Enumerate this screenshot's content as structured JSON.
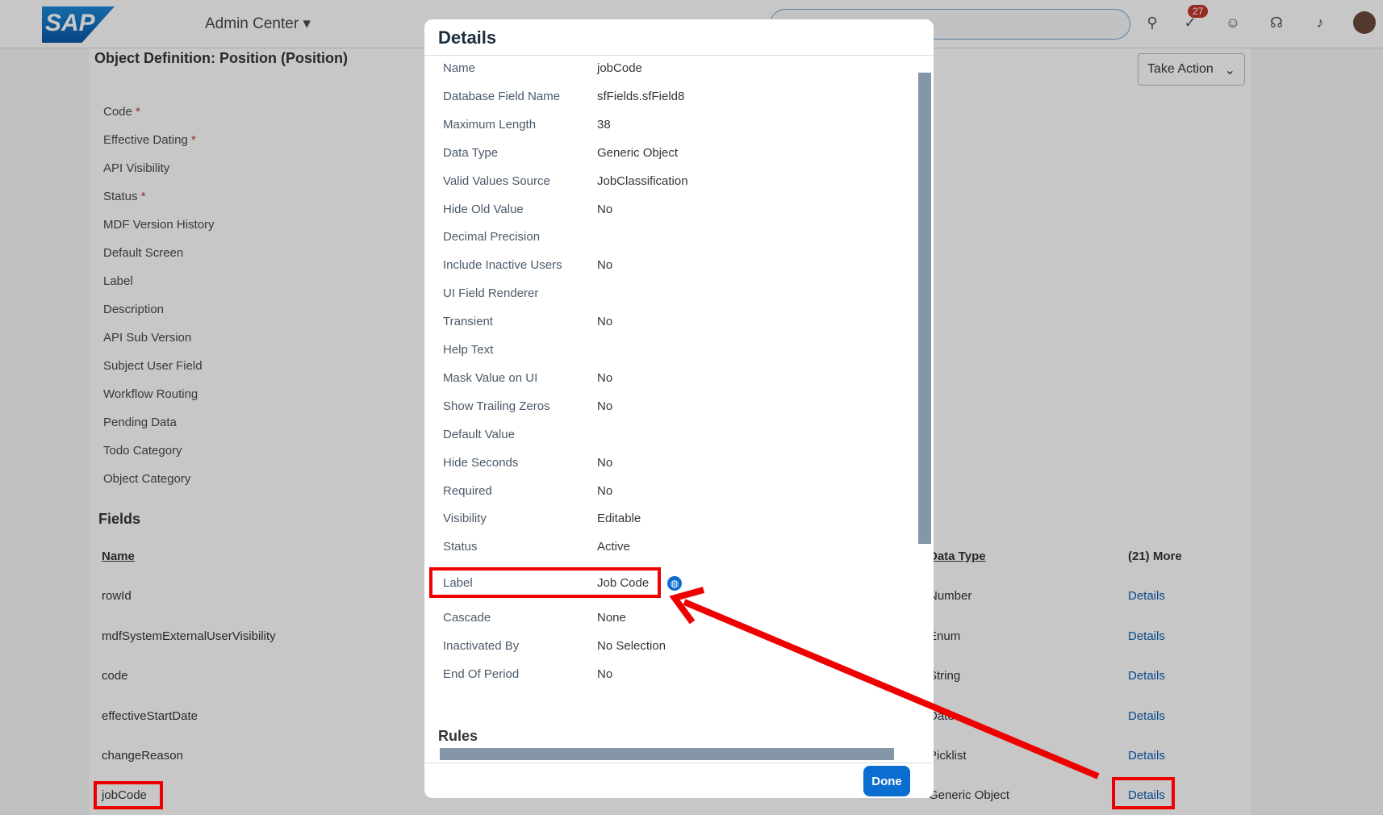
{
  "header": {
    "logo": "SAP",
    "app": "Admin Center ▾",
    "notification_count": "27"
  },
  "page": {
    "title": "Object Definition: Position (Position)",
    "take_action": "Take Action",
    "properties": [
      {
        "label": "Code",
        "required": true
      },
      {
        "label": "Effective Dating",
        "required": true
      },
      {
        "label": "API Visibility"
      },
      {
        "label": "Status",
        "required": true
      },
      {
        "label": "MDF Version History"
      },
      {
        "label": "Default Screen"
      },
      {
        "label": "Label"
      },
      {
        "label": "Description"
      },
      {
        "label": "API Sub Version"
      },
      {
        "label": "Subject User Field"
      },
      {
        "label": "Workflow Routing"
      },
      {
        "label": "Pending Data"
      },
      {
        "label": "Todo Category"
      },
      {
        "label": "Object Category"
      }
    ],
    "fields_heading": "Fields",
    "columns": {
      "name": "Name",
      "data_type": "Data Type",
      "more": "(21) More"
    },
    "fields": [
      {
        "name": "rowId",
        "type": "Number",
        "link": "Details"
      },
      {
        "name": "mdfSystemExternalUserVisibility",
        "type": "Enum",
        "link": "Details"
      },
      {
        "name": "code",
        "type": "String",
        "link": "Details"
      },
      {
        "name": "effectiveStartDate",
        "type": "Date",
        "link": "Details"
      },
      {
        "name": "changeReason",
        "type": "Picklist",
        "link": "Details"
      },
      {
        "name": "jobCode",
        "type": "Generic Object",
        "link": "Details"
      }
    ]
  },
  "dialog": {
    "title": "Details",
    "rows": [
      [
        "Name",
        "jobCode"
      ],
      [
        "Database Field Name",
        "sfFields.sfField8"
      ],
      [
        "Maximum Length",
        "38"
      ],
      [
        "Data Type",
        "Generic Object"
      ],
      [
        "Valid Values Source",
        "JobClassification"
      ],
      [
        "Hide Old Value",
        "No"
      ],
      [
        "Decimal Precision",
        ""
      ],
      [
        "Include Inactive Users",
        "No"
      ],
      [
        "UI Field Renderer",
        ""
      ],
      [
        "Transient",
        "No"
      ],
      [
        "Help Text",
        ""
      ],
      [
        "Mask Value on UI",
        "No"
      ],
      [
        "Show Trailing Zeros",
        "No"
      ],
      [
        "Default Value",
        ""
      ],
      [
        "Hide Seconds",
        "No"
      ],
      [
        "Required",
        "No"
      ],
      [
        "Visibility",
        "Editable"
      ],
      [
        "Status",
        "Active"
      ]
    ],
    "label_row": [
      "Label",
      "Job Code"
    ],
    "rows2": [
      [
        "Cascade",
        "None"
      ],
      [
        "Inactivated By",
        "No Selection"
      ],
      [
        "End Of Period",
        "No"
      ]
    ],
    "rules": "Rules",
    "done": "Done"
  },
  "colors": {
    "accent": "#0a6ed1",
    "highlight": "#e00000"
  }
}
